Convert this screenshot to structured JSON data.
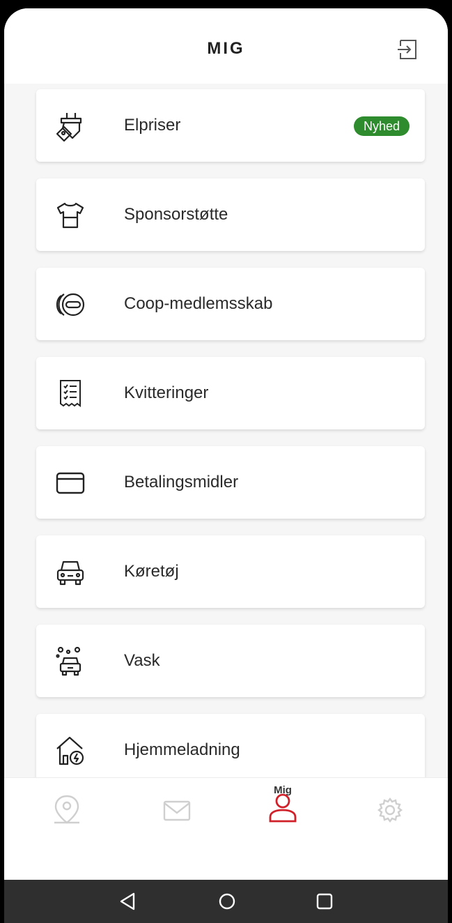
{
  "header": {
    "title": "MIG",
    "logout_icon": "logout-icon"
  },
  "menu": [
    {
      "label": "Elpriser",
      "icon": "plug-price-tag-icon",
      "badge": "Nyhed"
    },
    {
      "label": "Sponsorstøtte",
      "icon": "tshirt-icon"
    },
    {
      "label": "Coop-medlemsskab",
      "icon": "coop-card-icon"
    },
    {
      "label": "Kvitteringer",
      "icon": "receipt-icon"
    },
    {
      "label": "Betalingsmidler",
      "icon": "credit-card-icon"
    },
    {
      "label": "Køretøj",
      "icon": "car-icon"
    },
    {
      "label": "Vask",
      "icon": "car-wash-icon"
    },
    {
      "label": "Hjemmeladning",
      "icon": "home-charging-icon"
    }
  ],
  "bottom_nav": {
    "items": [
      {
        "icon": "map-pin-icon",
        "active": false
      },
      {
        "icon": "mail-icon",
        "active": false
      },
      {
        "icon": "user-icon",
        "label": "Mig",
        "active": true
      },
      {
        "icon": "gear-icon",
        "active": false
      }
    ]
  },
  "colors": {
    "accent": "#d0202a",
    "badge": "#2e8b2e",
    "inactive": "#cfcfcf"
  }
}
